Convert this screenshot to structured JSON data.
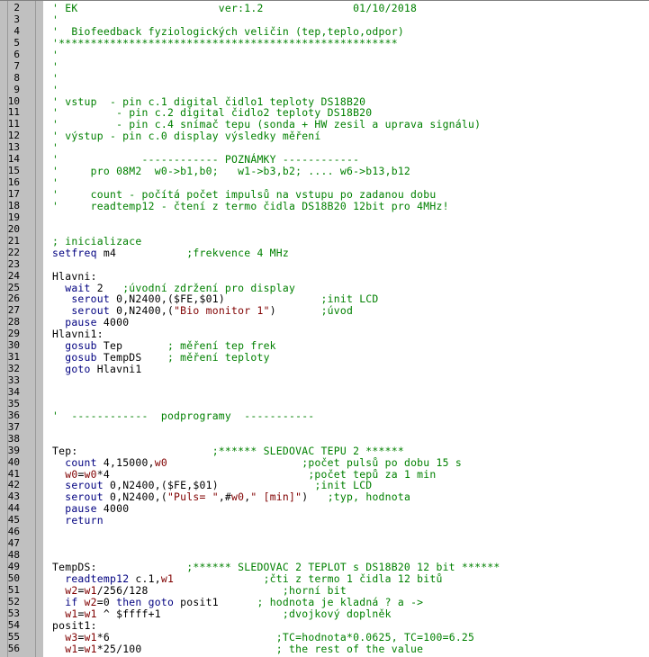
{
  "colors": {
    "comment": "#008000",
    "keyword": "#000080",
    "string": "#800000",
    "number": "#800000",
    "plain": "#000000",
    "gutter": "#c0c0c0"
  },
  "lines": [
    {
      "n": "2",
      "s": [
        [
          "c",
          "' EK                      ver:1.2              01/10/2018"
        ]
      ]
    },
    {
      "n": "3",
      "s": [
        [
          "c",
          "'"
        ]
      ]
    },
    {
      "n": "4",
      "s": [
        [
          "c",
          "'  Biofeedback fyziologických veličin (tep,teplo,odpor)"
        ]
      ]
    },
    {
      "n": "5",
      "s": [
        [
          "c",
          "'*****************************************************"
        ]
      ]
    },
    {
      "n": "6",
      "s": [
        [
          "c",
          "'"
        ]
      ]
    },
    {
      "n": "7",
      "s": [
        [
          "c",
          "'"
        ]
      ]
    },
    {
      "n": "8",
      "s": [
        [
          "c",
          "'"
        ]
      ]
    },
    {
      "n": "9",
      "s": [
        [
          "c",
          "'"
        ]
      ]
    },
    {
      "n": "10",
      "s": [
        [
          "c",
          "' vstup  - pin c.1 digital čidlo1 teploty DS18B20"
        ]
      ]
    },
    {
      "n": "11",
      "s": [
        [
          "c",
          "'         - pin c.2 digital čidlo2 teploty DS18B20"
        ]
      ]
    },
    {
      "n": "11",
      "s": [
        [
          "c",
          "'         - pin c.4 snímač tepu (sonda + HW zesil a uprava signálu)"
        ]
      ]
    },
    {
      "n": "12",
      "s": [
        [
          "c",
          "' výstup - pin c.0 display výsledky měření"
        ]
      ]
    },
    {
      "n": "13",
      "s": [
        [
          "c",
          "'"
        ]
      ]
    },
    {
      "n": "14",
      "s": [
        [
          "c",
          "'             ------------ POZNÁMKY ------------"
        ]
      ]
    },
    {
      "n": "15",
      "s": [
        [
          "c",
          "'     pro 08M2  w0->b1,b0;   w1->b3,b2; .... w6->b13,b12"
        ]
      ]
    },
    {
      "n": "16",
      "s": [
        [
          "c",
          "'"
        ]
      ]
    },
    {
      "n": "17",
      "s": [
        [
          "c",
          "'     count - počítá počet impulsů na vstupu po zadanou dobu"
        ]
      ]
    },
    {
      "n": "18",
      "s": [
        [
          "c",
          "'     readtemp12 - čtení z termo čidla DS18B20 12bit pro 4MHz!"
        ]
      ]
    },
    {
      "n": "19",
      "s": []
    },
    {
      "n": "20",
      "s": []
    },
    {
      "n": "21",
      "s": [
        [
          "c",
          "; inicializace"
        ]
      ]
    },
    {
      "n": "22",
      "s": [
        [
          "k",
          "setfreq"
        ],
        [
          "p",
          " m4           "
        ],
        [
          "c",
          ";frekvence 4 MHz"
        ]
      ]
    },
    {
      "n": "23",
      "s": []
    },
    {
      "n": "24",
      "s": [
        [
          "p",
          "Hlavni:"
        ]
      ]
    },
    {
      "n": "25",
      "s": [
        [
          "p",
          "  "
        ],
        [
          "k",
          "wait"
        ],
        [
          "p",
          " 2   "
        ],
        [
          "c",
          ";úvodní zdržení pro display"
        ]
      ]
    },
    {
      "n": "26",
      "s": [
        [
          "p",
          "   "
        ],
        [
          "k",
          "serout"
        ],
        [
          "p",
          " 0,N2400,($FE,$01)               "
        ],
        [
          "c",
          ";init LCD"
        ]
      ]
    },
    {
      "n": "27",
      "s": [
        [
          "p",
          "   "
        ],
        [
          "k",
          "serout"
        ],
        [
          "p",
          " 0,N2400,("
        ],
        [
          "s",
          "\"Bio monitor 1\""
        ],
        [
          "p",
          ")       "
        ],
        [
          "c",
          ";úvod"
        ]
      ]
    },
    {
      "n": "28",
      "s": [
        [
          "p",
          "  "
        ],
        [
          "k",
          "pause"
        ],
        [
          "p",
          " 4000"
        ]
      ]
    },
    {
      "n": "29",
      "s": [
        [
          "p",
          "Hlavni1:"
        ]
      ]
    },
    {
      "n": "30",
      "s": [
        [
          "p",
          "  "
        ],
        [
          "k",
          "gosub"
        ],
        [
          "p",
          " Tep       "
        ],
        [
          "c",
          "; měření tep frek"
        ]
      ]
    },
    {
      "n": "31",
      "s": [
        [
          "p",
          "  "
        ],
        [
          "k",
          "gosub"
        ],
        [
          "p",
          " TempDS    "
        ],
        [
          "c",
          "; měření teploty"
        ]
      ]
    },
    {
      "n": "32",
      "s": [
        [
          "p",
          "  "
        ],
        [
          "k",
          "goto"
        ],
        [
          "p",
          " Hlavni1"
        ]
      ]
    },
    {
      "n": "33",
      "s": []
    },
    {
      "n": "34",
      "s": []
    },
    {
      "n": "35",
      "s": []
    },
    {
      "n": "36",
      "s": [
        [
          "c",
          "'  ------------  podprogramy  -----------"
        ]
      ]
    },
    {
      "n": "37",
      "s": []
    },
    {
      "n": "38",
      "s": []
    },
    {
      "n": "39",
      "s": [
        [
          "p",
          "Tep:                     "
        ],
        [
          "c",
          ";****** SLEDOVAC TEPU 2 ******"
        ]
      ]
    },
    {
      "n": "40",
      "s": [
        [
          "p",
          "  "
        ],
        [
          "k",
          "count"
        ],
        [
          "p",
          " 4,15000,"
        ],
        [
          "n",
          "w0"
        ],
        [
          "p",
          "                     "
        ],
        [
          "c",
          ";počet pulsů po dobu 15 s"
        ]
      ]
    },
    {
      "n": "41",
      "s": [
        [
          "p",
          "  "
        ],
        [
          "n",
          "w0"
        ],
        [
          "p",
          "="
        ],
        [
          "n",
          "w0"
        ],
        [
          "p",
          "*4                               "
        ],
        [
          "c",
          ";počet tepů za 1 min"
        ]
      ]
    },
    {
      "n": "42",
      "s": [
        [
          "p",
          "  "
        ],
        [
          "k",
          "serout"
        ],
        [
          "p",
          " 0,N2400,($FE,$01)               "
        ],
        [
          "c",
          ";init LCD"
        ]
      ]
    },
    {
      "n": "43",
      "s": [
        [
          "p",
          "  "
        ],
        [
          "k",
          "serout"
        ],
        [
          "p",
          " 0,N2400,("
        ],
        [
          "s",
          "\"Puls= \""
        ],
        [
          "p",
          ",#"
        ],
        [
          "n",
          "w0"
        ],
        [
          "p",
          ","
        ],
        [
          "s",
          "\" [min]\""
        ],
        [
          "p",
          ")   "
        ],
        [
          "c",
          ";typ, hodnota"
        ]
      ]
    },
    {
      "n": "44",
      "s": [
        [
          "p",
          "  "
        ],
        [
          "k",
          "pause"
        ],
        [
          "p",
          " 4000"
        ]
      ]
    },
    {
      "n": "45",
      "s": [
        [
          "p",
          "  "
        ],
        [
          "k",
          "return"
        ]
      ]
    },
    {
      "n": "46",
      "s": []
    },
    {
      "n": "47",
      "s": []
    },
    {
      "n": "48",
      "s": []
    },
    {
      "n": "49",
      "s": [
        [
          "p",
          "TempDS:              "
        ],
        [
          "c",
          ";****** SLEDOVAC 2 TEPLOT s DS18B20 12 bit ******"
        ]
      ]
    },
    {
      "n": "50",
      "s": [
        [
          "p",
          "  "
        ],
        [
          "k",
          "readtemp12"
        ],
        [
          "p",
          " c.1,"
        ],
        [
          "n",
          "w1"
        ],
        [
          "p",
          "              "
        ],
        [
          "c",
          ";čti z termo 1 čidla 12 bitů"
        ]
      ]
    },
    {
      "n": "51",
      "s": [
        [
          "p",
          "  "
        ],
        [
          "n",
          "w2"
        ],
        [
          "p",
          "="
        ],
        [
          "n",
          "w1"
        ],
        [
          "p",
          "/256/128                     "
        ],
        [
          "c",
          ";horní bit"
        ]
      ]
    },
    {
      "n": "52",
      "s": [
        [
          "p",
          "  "
        ],
        [
          "k",
          "if"
        ],
        [
          "p",
          " "
        ],
        [
          "n",
          "w2"
        ],
        [
          "p",
          "=0 "
        ],
        [
          "k",
          "then goto"
        ],
        [
          "p",
          " posit1      "
        ],
        [
          "c",
          "; hodnota je kladná ? a ->"
        ]
      ]
    },
    {
      "n": "53",
      "s": [
        [
          "p",
          "  "
        ],
        [
          "n",
          "w1"
        ],
        [
          "p",
          "="
        ],
        [
          "n",
          "w1"
        ],
        [
          "p",
          " ^ $ffff+1                   "
        ],
        [
          "c",
          ";dvojkový doplněk"
        ]
      ]
    },
    {
      "n": "54",
      "s": [
        [
          "p",
          "posit1:"
        ]
      ]
    },
    {
      "n": "55",
      "s": [
        [
          "p",
          "  "
        ],
        [
          "n",
          "w3"
        ],
        [
          "p",
          "="
        ],
        [
          "n",
          "w1"
        ],
        [
          "p",
          "*6                          "
        ],
        [
          "c",
          ";TC=hodnota*0.0625, TC=100=6.25"
        ]
      ]
    },
    {
      "n": "56",
      "s": [
        [
          "p",
          "  "
        ],
        [
          "n",
          "w1"
        ],
        [
          "p",
          "="
        ],
        [
          "n",
          "w1"
        ],
        [
          "p",
          "*25/100                     "
        ],
        [
          "c",
          "; the rest of the value"
        ]
      ]
    }
  ]
}
